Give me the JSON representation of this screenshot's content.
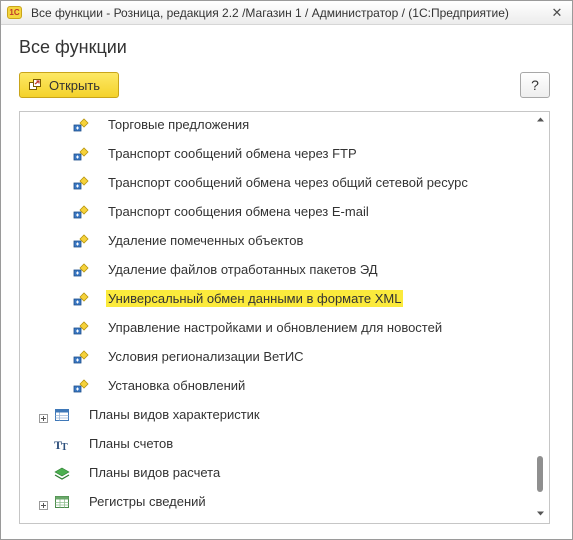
{
  "window": {
    "app_logo_text": "1С",
    "title": "Все функции - Розница, редакция 2.2 /Магазин 1 / Администратор / (1С:Предприятие)",
    "close_glyph": "✕"
  },
  "form": {
    "title": "Все функции"
  },
  "toolbar": {
    "open_label": "Открыть",
    "open_icon": "open-icon",
    "help_label": "?"
  },
  "tree": {
    "processing_items": [
      {
        "label": "Торговые предложения",
        "icon": "processing-icon"
      },
      {
        "label": "Транспорт сообщений обмена через FTP",
        "icon": "processing-icon"
      },
      {
        "label": "Транспорт сообщений обмена через общий сетевой ресурс",
        "icon": "processing-icon"
      },
      {
        "label": "Транспорт сообщения обмена через E-mail",
        "icon": "processing-icon"
      },
      {
        "label": "Удаление помеченных объектов",
        "icon": "processing-icon"
      },
      {
        "label": "Удаление файлов отработанных пакетов ЭД",
        "icon": "processing-icon"
      },
      {
        "label": "Универсальный обмен данными в формате XML",
        "icon": "processing-icon",
        "selected": true
      },
      {
        "label": "Управление настройками и обновлением для новостей",
        "icon": "processing-icon"
      },
      {
        "label": "Условия регионализации ВетИС",
        "icon": "processing-icon"
      },
      {
        "label": "Установка обновлений",
        "icon": "processing-icon"
      }
    ],
    "sections": [
      {
        "label": "Планы видов характеристик",
        "icon": "chart-of-characteristic-types-icon",
        "expandable": true
      },
      {
        "label": "Планы счетов",
        "icon": "chart-of-accounts-icon",
        "expandable": false
      },
      {
        "label": "Планы видов расчета",
        "icon": "chart-of-calculation-types-icon",
        "expandable": false
      },
      {
        "label": "Регистры сведений",
        "icon": "information-register-icon",
        "expandable": true
      }
    ]
  },
  "colors": {
    "accent_yellow": "#f4d22b",
    "selection": "#fbea3c"
  }
}
